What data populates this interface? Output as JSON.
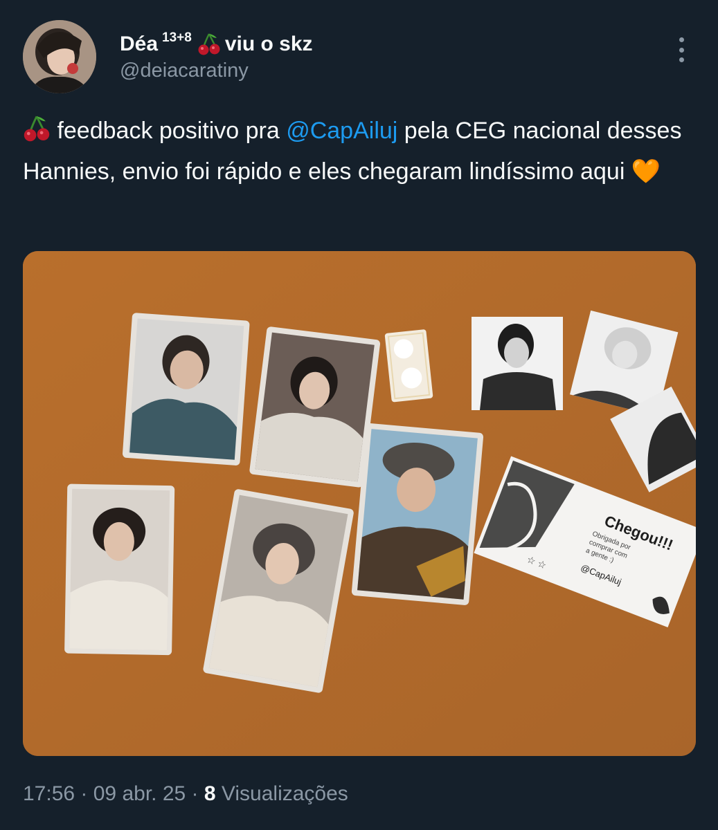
{
  "author": {
    "display_name": "Déa",
    "superscript": "13+8",
    "name_suffix": "viu o skz",
    "handle": "@deiacaratiny"
  },
  "tweet": {
    "text_before_mention": " feedback positivo pra ",
    "mention": "@CapAiluj",
    "text_after_mention": " pela CEG nacional desses Hannies, envio foi rápido e eles chegaram lindíssimo aqui ",
    "heart_emoji": "🧡"
  },
  "media": {
    "card_title": "Chegou!!!",
    "card_handle": "@CapAiluj",
    "card_body": [
      "Obrigada por",
      "comprar com",
      "a gente :)"
    ]
  },
  "meta": {
    "time": "17:56",
    "date": "09 abr. 25",
    "views_count": "8",
    "views_label": "Visualizações",
    "separator": " · "
  },
  "colors": {
    "background": "#15202b",
    "text": "#f7f9f9",
    "secondary": "#8b98a5",
    "link": "#1d9bf0",
    "cherry": "#c0182a"
  },
  "icons": [
    "cherry-icon",
    "more-options-icon",
    "orange-heart-emoji"
  ]
}
